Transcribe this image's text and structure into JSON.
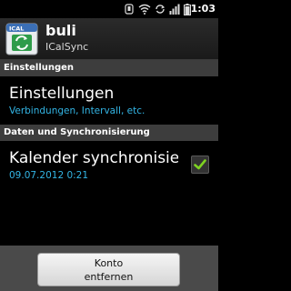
{
  "statusbar": {
    "time": "1:03",
    "icons": [
      "usb-debug-icon",
      "wifi-icon",
      "sync-icon",
      "signal-icon",
      "battery-icon"
    ]
  },
  "account": {
    "name": "buli",
    "type": "ICalSync",
    "icon_label": "ICAL"
  },
  "sections": {
    "settings_header": "Einstellungen",
    "data_sync_header": "Daten und Synchronisierung"
  },
  "prefs": {
    "settings": {
      "title": "Einstellungen",
      "summary": "Verbindungen, Intervall, etc."
    },
    "calendar_sync": {
      "title": "Kalender synchronisieren",
      "summary": "09.07.2012 0:21",
      "checked": true
    }
  },
  "footer": {
    "remove_line1": "Konto",
    "remove_line2": "entfernen"
  },
  "colors": {
    "accent": "#33b5e5",
    "check": "#7ed321"
  }
}
